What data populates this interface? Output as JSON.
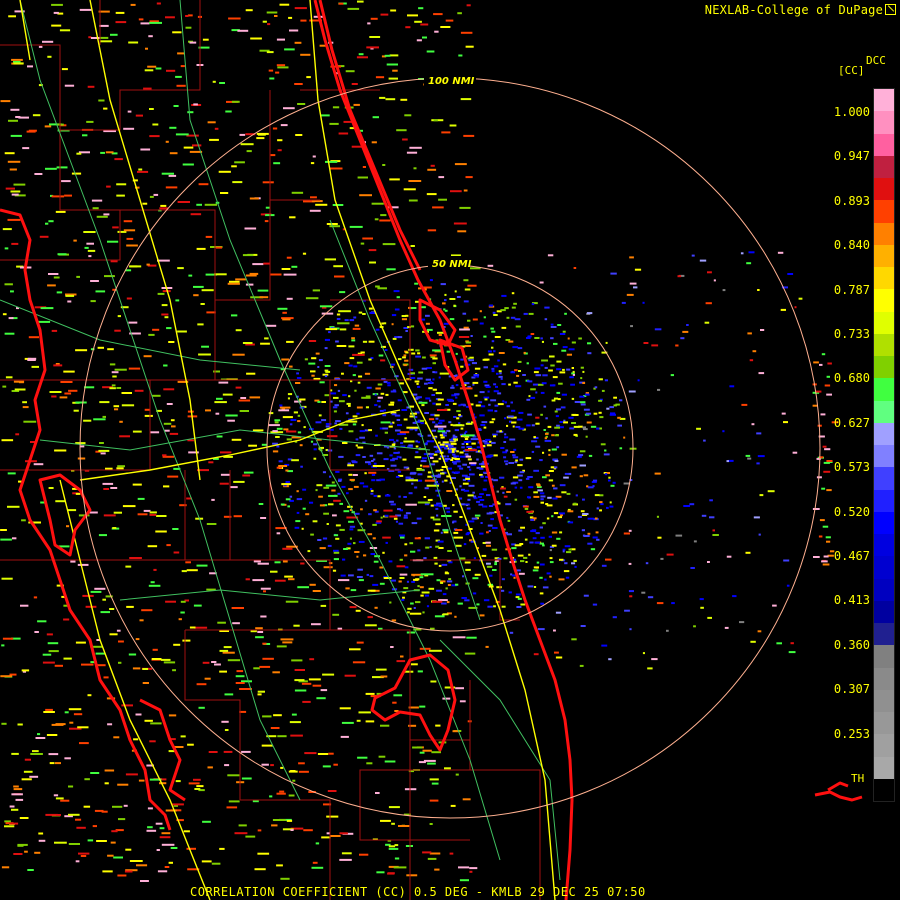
{
  "credit": "NEXLAB-College of DuPage",
  "product_label": "CORRELATION COEFFICIENT (CC) 0.5 DEG - KMLB 29 DEC 25 07:50",
  "legend": {
    "code": "DCC",
    "unit": "[CC]",
    "ticks": [
      "1.000",
      "0.947",
      "0.893",
      "0.840",
      "0.787",
      "0.733",
      "0.680",
      "0.627",
      "0.573",
      "0.520",
      "0.467",
      "0.413",
      "0.360",
      "0.307",
      "0.253"
    ],
    "bottom_label": "TH",
    "colors_top_to_bottom": [
      "#ffb0d8",
      "#ff90c0",
      "#ff60a0",
      "#c02040",
      "#e01010",
      "#ff4000",
      "#ff8000",
      "#ffb000",
      "#ffd800",
      "#ffff00",
      "#e0ff00",
      "#b0e000",
      "#80d000",
      "#40ff40",
      "#60ff80",
      "#a0a0ff",
      "#8080ff",
      "#4040ff",
      "#2020ff",
      "#0000ff",
      "#0000e0",
      "#0000d0",
      "#0000c0",
      "#0000a0",
      "#202090",
      "#808080",
      "#8a8a8a",
      "#909090",
      "#989898",
      "#a0a0a0",
      "#a8a8a8",
      "#000000"
    ]
  },
  "range_rings": [
    {
      "label": "50 NMI"
    },
    {
      "label": "100 NMI"
    }
  ],
  "colors": {
    "background": "#000000",
    "label_text": "#ffff00",
    "coastline": "#ff0000",
    "county_lines": "#a01010",
    "highways": "#ffff00",
    "roads": "#40c060",
    "range_ring": "#ffb090"
  }
}
